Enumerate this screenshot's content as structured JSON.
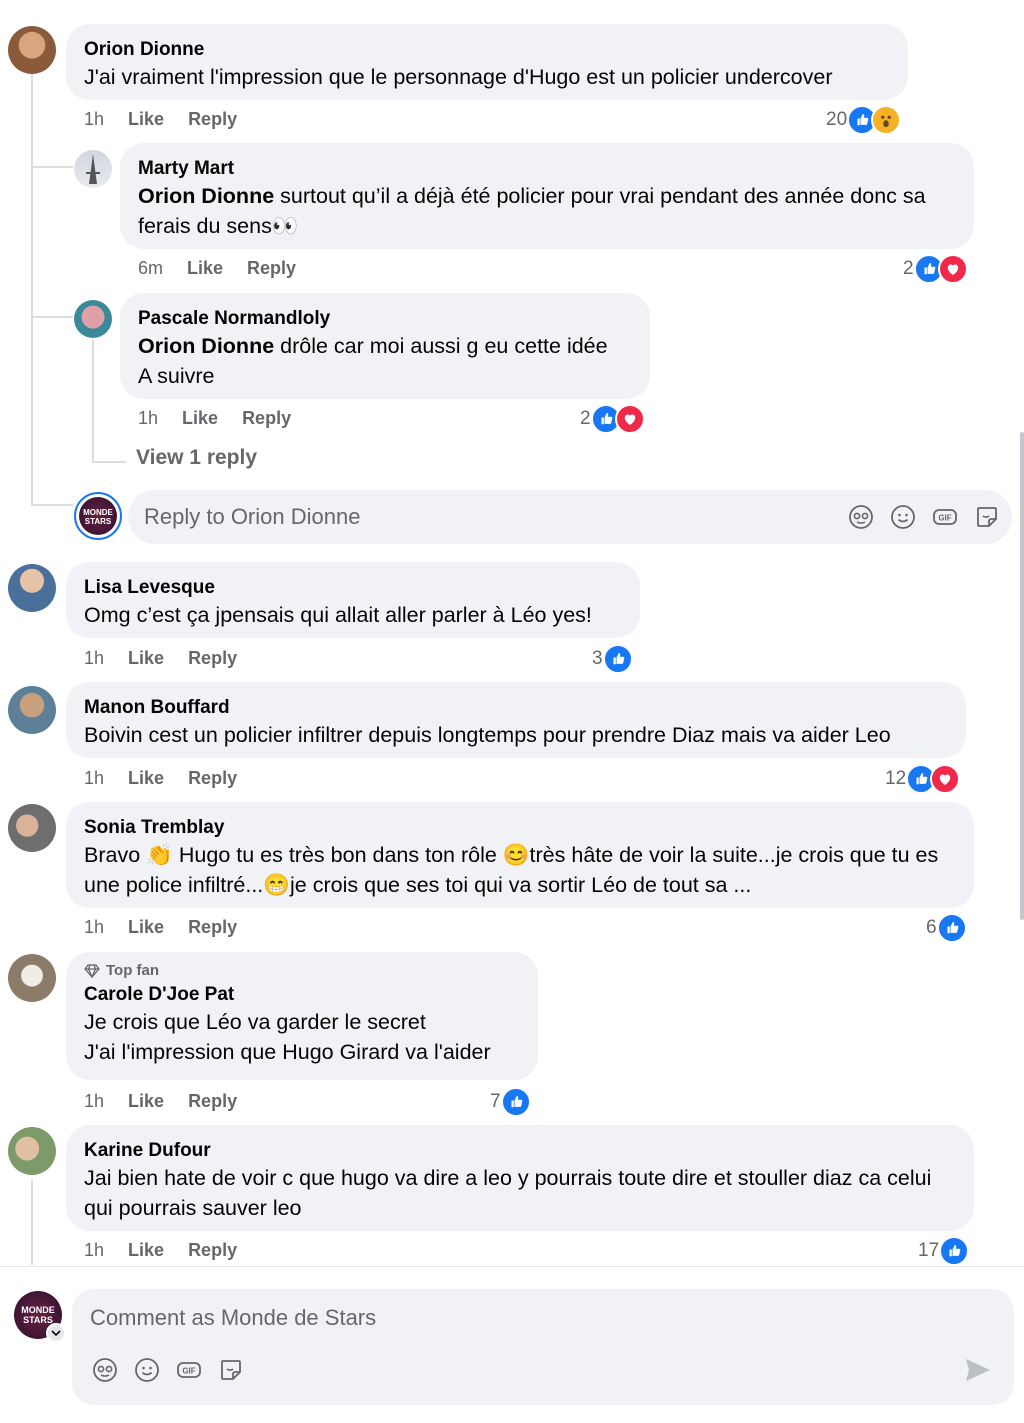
{
  "comments": [
    {
      "author": "Orion Dionne",
      "text": "J'ai vraiment l'impression que le personnage d'Hugo est un policier undercover",
      "time": "1h",
      "like": "Like",
      "reply": "Reply",
      "reactions_count": "20",
      "replies": [
        {
          "author": "Marty Mart",
          "mention": "Orion Dionne",
          "text": " surtout qu’il a déjà été policier pour vrai pendant des année donc sa ferais du sens👀",
          "time": "6m",
          "like": "Like",
          "reply": "Reply",
          "reactions_count": "2"
        },
        {
          "author": "Pascale Normandloly",
          "mention": "Orion Dionne",
          "text": " drôle car moi aussi g eu cette idée\nA suivre",
          "time": "1h",
          "like": "Like",
          "reply": "Reply",
          "reactions_count": "2"
        }
      ],
      "view_replies": "View 1 reply",
      "reply_placeholder": "Reply to Orion Dionne"
    },
    {
      "author": "Lisa Levesque",
      "text": "Omg c’est ça jpensais qui allait aller parler à Léo yes!",
      "time": "1h",
      "like": "Like",
      "reply": "Reply",
      "reactions_count": "3"
    },
    {
      "author": "Manon Bouffard",
      "text": "Boivin cest un policier infiltrer depuis longtemps pour prendre Diaz mais va aider Leo",
      "time": "1h",
      "like": "Like",
      "reply": "Reply",
      "reactions_count": "12"
    },
    {
      "author": "Sonia Tremblay",
      "text": "Bravo 👏 Hugo tu es très bon dans ton rôle 😊très hâte de voir la suite...je crois que tu es une police infiltré...😁je crois que ses toi qui va sortir Léo de tout sa ...",
      "time": "1h",
      "like": "Like",
      "reply": "Reply",
      "reactions_count": "6"
    },
    {
      "badge": "Top fan",
      "author": "Carole D'Joe Pat",
      "text": "Je crois que Léo va garder le secret\nJ'ai l'impression que Hugo Girard va l'aider",
      "time": "1h",
      "like": "Like",
      "reply": "Reply",
      "reactions_count": "7"
    },
    {
      "author": "Karine Dufour",
      "text": "Jai bien hate de voir c que hugo va dire a leo y pourrais toute dire et stouller diaz ca celui qui pourrais sauver leo",
      "time": "1h",
      "like": "Like",
      "reply": "Reply",
      "reactions_count": "17"
    }
  ],
  "page_avatar_text": [
    "MONDE",
    "STARS"
  ],
  "composer": {
    "placeholder": "Comment as Monde de Stars"
  },
  "icons": [
    "avatar-sticker-icon",
    "emoji-icon",
    "gif-icon",
    "sticker-icon",
    "send-icon",
    "like-reaction-icon",
    "love-reaction-icon",
    "wow-reaction-icon",
    "diamond-icon"
  ],
  "colors": {
    "like": "#1877f2",
    "love": "#f02849",
    "wow": "#f7b125",
    "bubble": "#f0f2f5",
    "meta": "#65676b"
  }
}
